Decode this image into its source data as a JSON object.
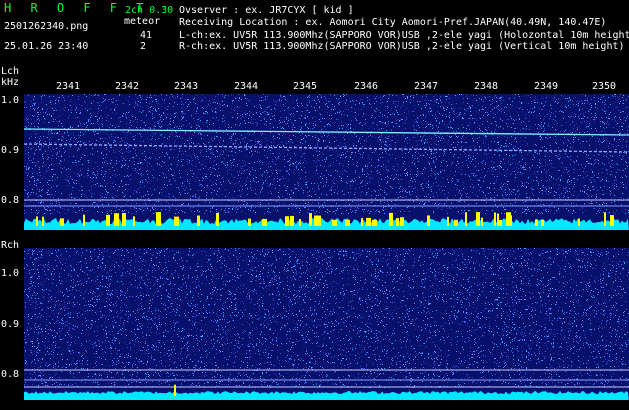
{
  "app": {
    "logo": "H R O F F T",
    "version": "2ch 0.30",
    "file_name": "2501262340.png",
    "date_time": "25.01.26 23:40"
  },
  "meteor": {
    "label": "meteor",
    "lch_count": "41",
    "rch_count": "2"
  },
  "info": {
    "observer": "Ovserver           : ex. JR7CYX [ kid ]",
    "location": "Receiving Location : ex. Aomori City Aomori-Pref.JAPAN(40.49N, 140.47E)",
    "lch": "L-ch:ex. UV5R 113.900Mhz(SAPPORO VOR)USB ,2-ele yagi (Holozontal 10m height)",
    "rch": "R-ch:ex. UV5R 113.900Mhz(SAPPORO VOR)USB ,2-ele yagi (Vertical 10m height)"
  },
  "time_ticks": [
    "2341",
    "2342",
    "2343",
    "2344",
    "2345",
    "2346",
    "2347",
    "2348",
    "2349",
    "2350"
  ],
  "lch_panel": {
    "label": "Lch",
    "unit": "kHz",
    "freq_labels": [
      "1.0",
      "0.9",
      "0.8"
    ]
  },
  "rch_panel": {
    "label": "Rch",
    "freq_labels": [
      "1.0",
      "0.9",
      "0.8"
    ]
  },
  "colors": {
    "background": "#000000",
    "panel_bg": "#07106b",
    "logo_green": "#00ff30",
    "signal_cyan": "#00e8ff",
    "meteor_yellow": "#ffff00"
  }
}
